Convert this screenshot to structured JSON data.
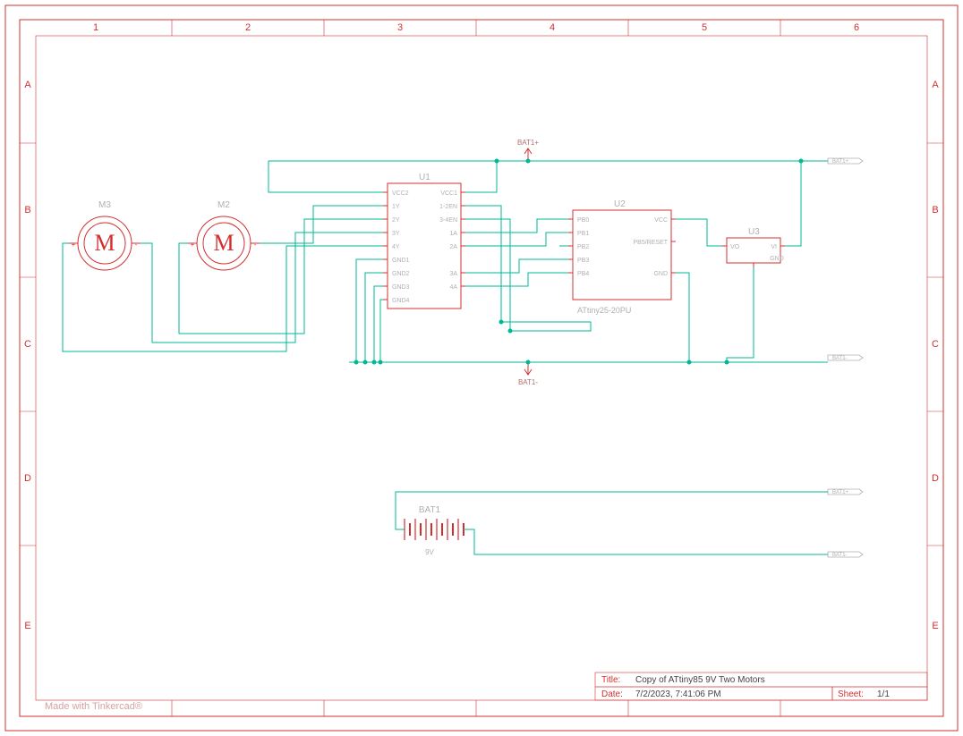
{
  "grid": {
    "cols": [
      "1",
      "2",
      "3",
      "4",
      "5",
      "6"
    ],
    "rows": [
      "A",
      "B",
      "C",
      "D",
      "E"
    ]
  },
  "watermark": "Made with Tinkercad®",
  "titleblock": {
    "title_label": "Title:",
    "title": "Copy of ATtiny85 9V Two Motors",
    "date_label": "Date:",
    "date": "7/2/2023, 7:41:06 PM",
    "sheet_label": "Sheet:",
    "sheet": "1/1"
  },
  "components": {
    "M3": {
      "ref": "M3",
      "plus": "+",
      "minus": "-",
      "letter": "M"
    },
    "M2": {
      "ref": "M2",
      "plus": "+",
      "minus": "-",
      "letter": "M"
    },
    "U1": {
      "ref": "U1",
      "left": [
        "VCC2",
        "1Y",
        "2Y",
        "3Y",
        "4Y",
        "GND1",
        "GND2",
        "GND3",
        "GND4"
      ],
      "right": [
        "VCC1",
        "1-2EN",
        "3-4EN",
        "1A",
        "2A",
        "3A",
        "4A"
      ]
    },
    "U2": {
      "ref": "U2",
      "val": "ATtiny25-20PU",
      "left": [
        "PB0",
        "PB1",
        "PB2",
        "PB3",
        "PB4"
      ],
      "right": [
        "VCC",
        "PB5/RESET",
        "GND"
      ]
    },
    "U3": {
      "ref": "U3",
      "pins": {
        "vo": "VO",
        "vi": "VI",
        "gnd": "GND"
      }
    },
    "BAT1": {
      "ref": "BAT1",
      "val": "9V"
    }
  },
  "nets": {
    "bat_p": "BAT1+",
    "bat_n": "BAT1-",
    "port_p": "BAT1+",
    "port_n": "BAT1-"
  }
}
